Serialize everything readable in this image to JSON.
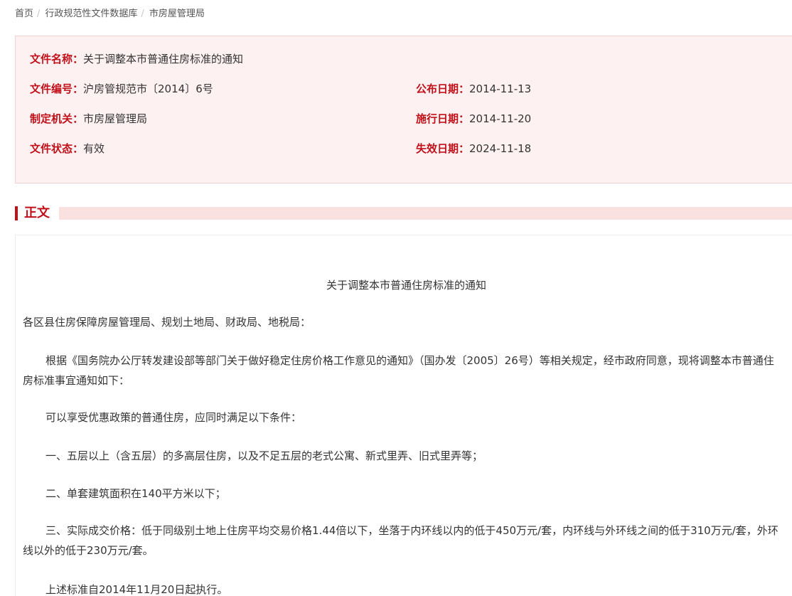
{
  "breadcrumb": {
    "items": [
      "首页",
      "行政规范性文件数据库",
      "市房屋管理局"
    ],
    "separator": "/"
  },
  "info": {
    "name_label": "文件名称：",
    "name_value": "关于调整本市普通住房标准的通知",
    "number_label": "文件编号：",
    "number_value": "沪房管规范市〔2014〕6号",
    "publish_label": "公布日期：",
    "publish_value": "2014-11-13",
    "agency_label": "制定机关：",
    "agency_value": "市房屋管理局",
    "effective_label": "施行日期：",
    "effective_value": "2014-11-20",
    "status_label": "文件状态：",
    "status_value": "有效",
    "expiry_label": "失效日期：",
    "expiry_value": "2024-11-18"
  },
  "section": {
    "title": "正文"
  },
  "content": {
    "title": "关于调整本市普通住房标准的通知",
    "addressee": "各区县住房保障房屋管理局、规划土地局、财政局、地税局：",
    "para1": "根据《国务院办公厅转发建设部等部门关于做好稳定住房价格工作意见的通知》（国办发〔2005〕26号）等相关规定，经市政府同意，现将调整本市普通住房标准事宜通知如下：",
    "para2": "可以享受优惠政策的普通住房，应同时满足以下条件：",
    "para3": "一、五层以上（含五层）的多高层住房，以及不足五层的老式公寓、新式里弄、旧式里弄等；",
    "para4": "二、单套建筑面积在140平方米以下；",
    "para5": "三、实际成交价格：低于同级别土地上住房平均交易价格1.44倍以下，坐落于内环线以内的低于450万元/套，内环线与外环线之间的低于310万元/套，外环线以外的低于230万元/套。",
    "para6": "上述标准自2014年11月20日起执行。"
  },
  "colors": {
    "accent": "#c0101a",
    "info_bg": "#fdf1f1",
    "section_line": "#f9e1e1"
  }
}
